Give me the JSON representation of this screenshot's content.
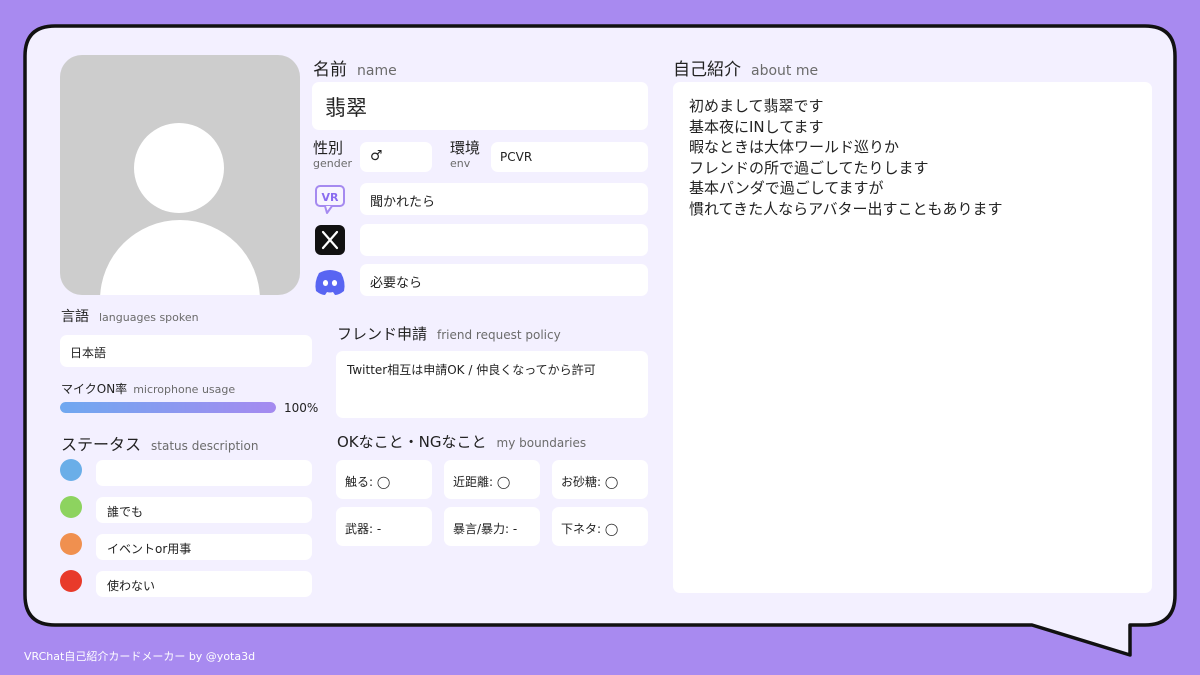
{
  "name_section": {
    "label": "名前",
    "sub": "name",
    "value": "翡翠"
  },
  "gender": {
    "label": "性別",
    "sub": "gender",
    "value": "♂"
  },
  "env": {
    "label": "環境",
    "sub": "env",
    "value": "PCVR"
  },
  "social": {
    "vrchat": {
      "icon": "vrchat-icon",
      "value": "聞かれたら"
    },
    "x": {
      "icon": "x-icon",
      "value": ""
    },
    "discord": {
      "icon": "discord-icon",
      "value": "必要なら"
    }
  },
  "languages": {
    "label": "言語",
    "sub": "languages spoken",
    "value": "日本語"
  },
  "mic": {
    "label": "マイクON率",
    "sub": "microphone usage",
    "percent": 100,
    "value_text": "100%"
  },
  "status": {
    "label": "ステータス",
    "sub": "status description",
    "items": [
      {
        "color": "#6aaee8",
        "text": ""
      },
      {
        "color": "#8dd35f",
        "text": "誰でも"
      },
      {
        "color": "#f0904f",
        "text": "イベントor用事"
      },
      {
        "color": "#e83a2a",
        "text": "使わない"
      }
    ]
  },
  "friend": {
    "label": "フレンド申請",
    "sub": "friend request policy",
    "value": "Twitter相互は申請OK / 仲良くなってから許可"
  },
  "boundaries": {
    "label": "OKなこと・NGなこと",
    "sub": "my boundaries",
    "items": [
      "触る: ◯",
      "近距離: ◯",
      "お砂糖: ◯",
      "武器: -",
      "暴言/暴力: -",
      "下ネタ: ◯"
    ]
  },
  "about": {
    "label": "自己紹介",
    "sub": "about me",
    "text": "初めまして翡翠です\n基本夜にINしてます\n暇なときは大体ワールド巡りか\nフレンドの所で過ごしてたりします\n基本パンダで過ごしてますが\n慣れてきた人ならアバター出すこともあります"
  },
  "footer": "VRChat自己紹介カードメーカー by @yota3d",
  "colors": {
    "background": "#a88af0",
    "card": "#f3f0ff",
    "outline": "#111111"
  }
}
